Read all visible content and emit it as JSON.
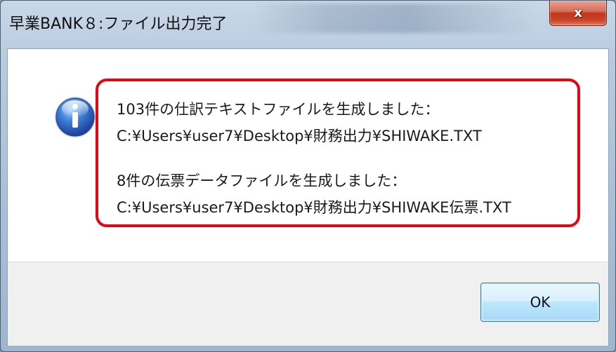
{
  "window": {
    "title": "早業BANK８:ファイル出力完了",
    "close_label": "x"
  },
  "dialog": {
    "icon": "info-icon",
    "message": {
      "line1": "103件の仕訳テキストファイルを生成しました：",
      "line2": "C:¥Users¥user7¥Desktop¥財務出力¥SHIWAKE.TXT",
      "line3": "8件の伝票データファイルを生成しました：",
      "line4": "C:¥Users¥user7¥Desktop¥財務出力¥SHIWAKE伝票.TXT"
    },
    "highlight_color": "#e30613"
  },
  "footer": {
    "ok_label": "OK"
  }
}
